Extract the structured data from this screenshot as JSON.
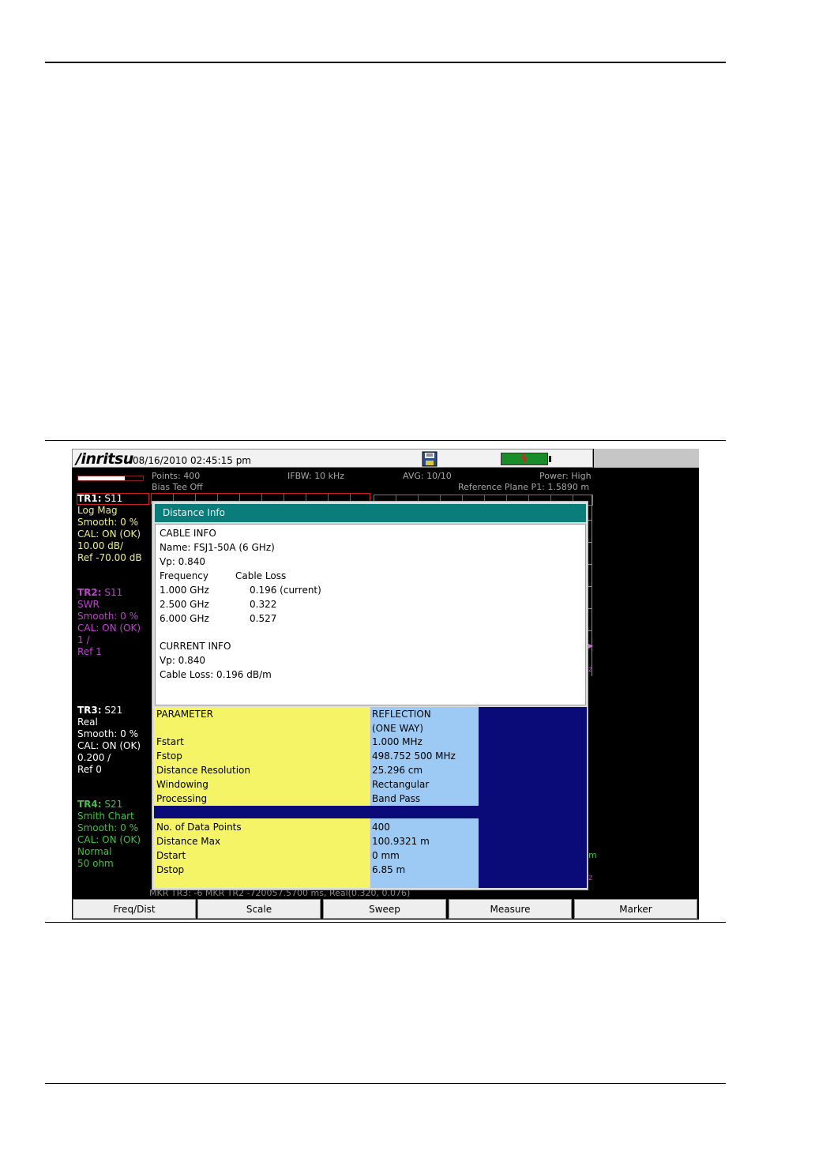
{
  "header": {
    "brand": "/inritsu",
    "datetime": "08/16/2010 02:45:15 pm"
  },
  "status": {
    "points": "Points: 400",
    "ifbw": "IFBW: 10 kHz",
    "avg": "AVG: 10/10",
    "power": "Power: High",
    "bias_tee": "Bias Tee Off",
    "ref_plane": "Reference Plane P1: 1.5890 m",
    "sweep_progress": 0.72
  },
  "traces": {
    "tr1": {
      "head": "TR1:",
      "param": "S11",
      "lines": [
        "Log Mag",
        "Smooth: 0 %",
        "CAL: ON (OK)",
        "10.00 dB/",
        "Ref -70.00 dB"
      ]
    },
    "tr2": {
      "head": "TR2:",
      "param": "S11",
      "lines": [
        "SWR",
        "Smooth: 0 %",
        "CAL: ON (OK)",
        "1 /",
        "Ref 1"
      ]
    },
    "tr3": {
      "head": "TR3:",
      "param": "S21",
      "lines": [
        "Real",
        "Smooth: 0 %",
        "CAL: ON (OK)",
        "0.200 /",
        "Ref 0"
      ]
    },
    "tr4": {
      "head": "TR4:",
      "param": "S21",
      "lines": [
        "Smith Chart",
        "Smooth: 0 %",
        "CAL: ON (OK)",
        "Normal",
        "50 ohm"
      ]
    }
  },
  "graph": {
    "marker_text": "MKR TR3: -6 MKR TR2 -720057.5700 ms, Real(0.320, 0.076)"
  },
  "dialog": {
    "title": "Distance Info",
    "cable_info": {
      "heading": "CABLE INFO",
      "name": "Name: FSJ1-50A (6 GHz)",
      "vp": "Vp: 0.840",
      "col_freq": "Frequency",
      "col_loss": "Cable Loss",
      "rows": [
        {
          "freq": "1.000 GHz",
          "loss": "0.196 (current)"
        },
        {
          "freq": "2.500 GHz",
          "loss": "0.322"
        },
        {
          "freq": "6.000 GHz",
          "loss": "0.527"
        }
      ]
    },
    "current_info": {
      "heading": "CURRENT INFO",
      "vp": "Vp: 0.840",
      "cable_loss": "Cable Loss: 0.196 dB/m"
    },
    "table": {
      "param_header": "PARAMETER",
      "value_header": "REFLECTION",
      "value_header2": "(ONE WAY)",
      "rows": [
        {
          "param": "Fstart",
          "value": "1.000 MHz"
        },
        {
          "param": "Fstop",
          "value": "498.752 500 MHz"
        },
        {
          "param": "Distance Resolution",
          "value": "25.296 cm"
        },
        {
          "param": "Windowing",
          "value": "Rectangular"
        },
        {
          "param": "Processing",
          "value": "Band Pass"
        }
      ],
      "rows2": [
        {
          "param": "No. of Data Points",
          "value": "400"
        },
        {
          "param": "Distance Max",
          "value": "100.9321 m"
        },
        {
          "param": "Dstart",
          "value": "0 mm"
        },
        {
          "param": "Dstop",
          "value": "6.85 m"
        }
      ]
    }
  },
  "softkeys": [
    "Freq/Dist",
    "Scale",
    "Sweep",
    "Measure",
    "Marker"
  ],
  "colors": {
    "dialog_title": "#0a7d7a",
    "param_column": "#f4f466",
    "value_column": "#9ccaf4",
    "dark_column": "#0a0a78",
    "tr2": "#c040d0",
    "tr4": "#40c040"
  }
}
